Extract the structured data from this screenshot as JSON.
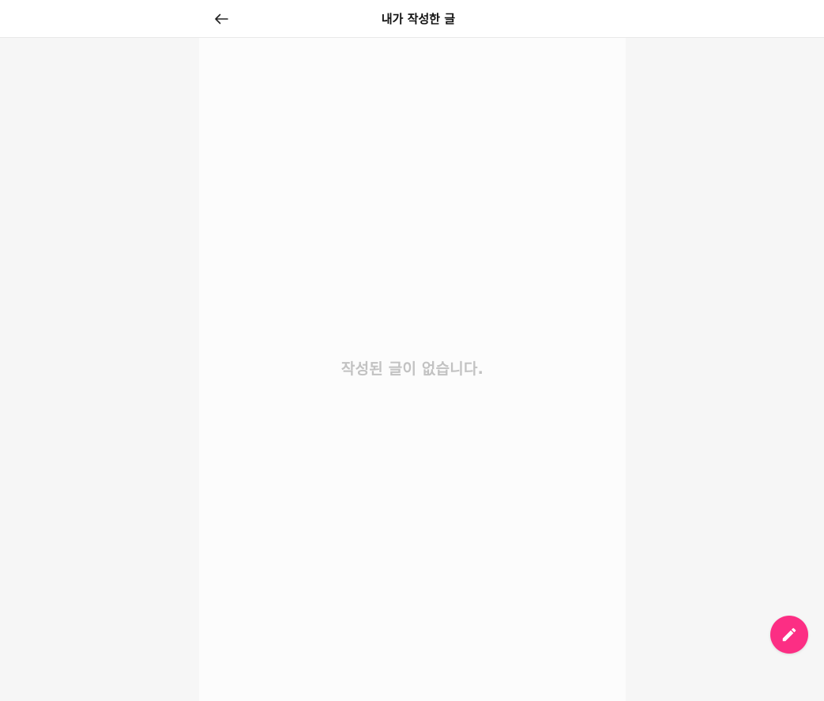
{
  "header": {
    "title": "내가 작성한 글",
    "back_icon": "arrow-left-icon"
  },
  "main": {
    "empty_message": "작성된 글이 없습니다."
  },
  "fab": {
    "icon": "pencil-icon",
    "color": "#fc2e84"
  },
  "colors": {
    "background": "#f6f6f6",
    "content_background": "#fcfcfc",
    "title_text": "#111111",
    "empty_text": "#c2c2c2"
  }
}
